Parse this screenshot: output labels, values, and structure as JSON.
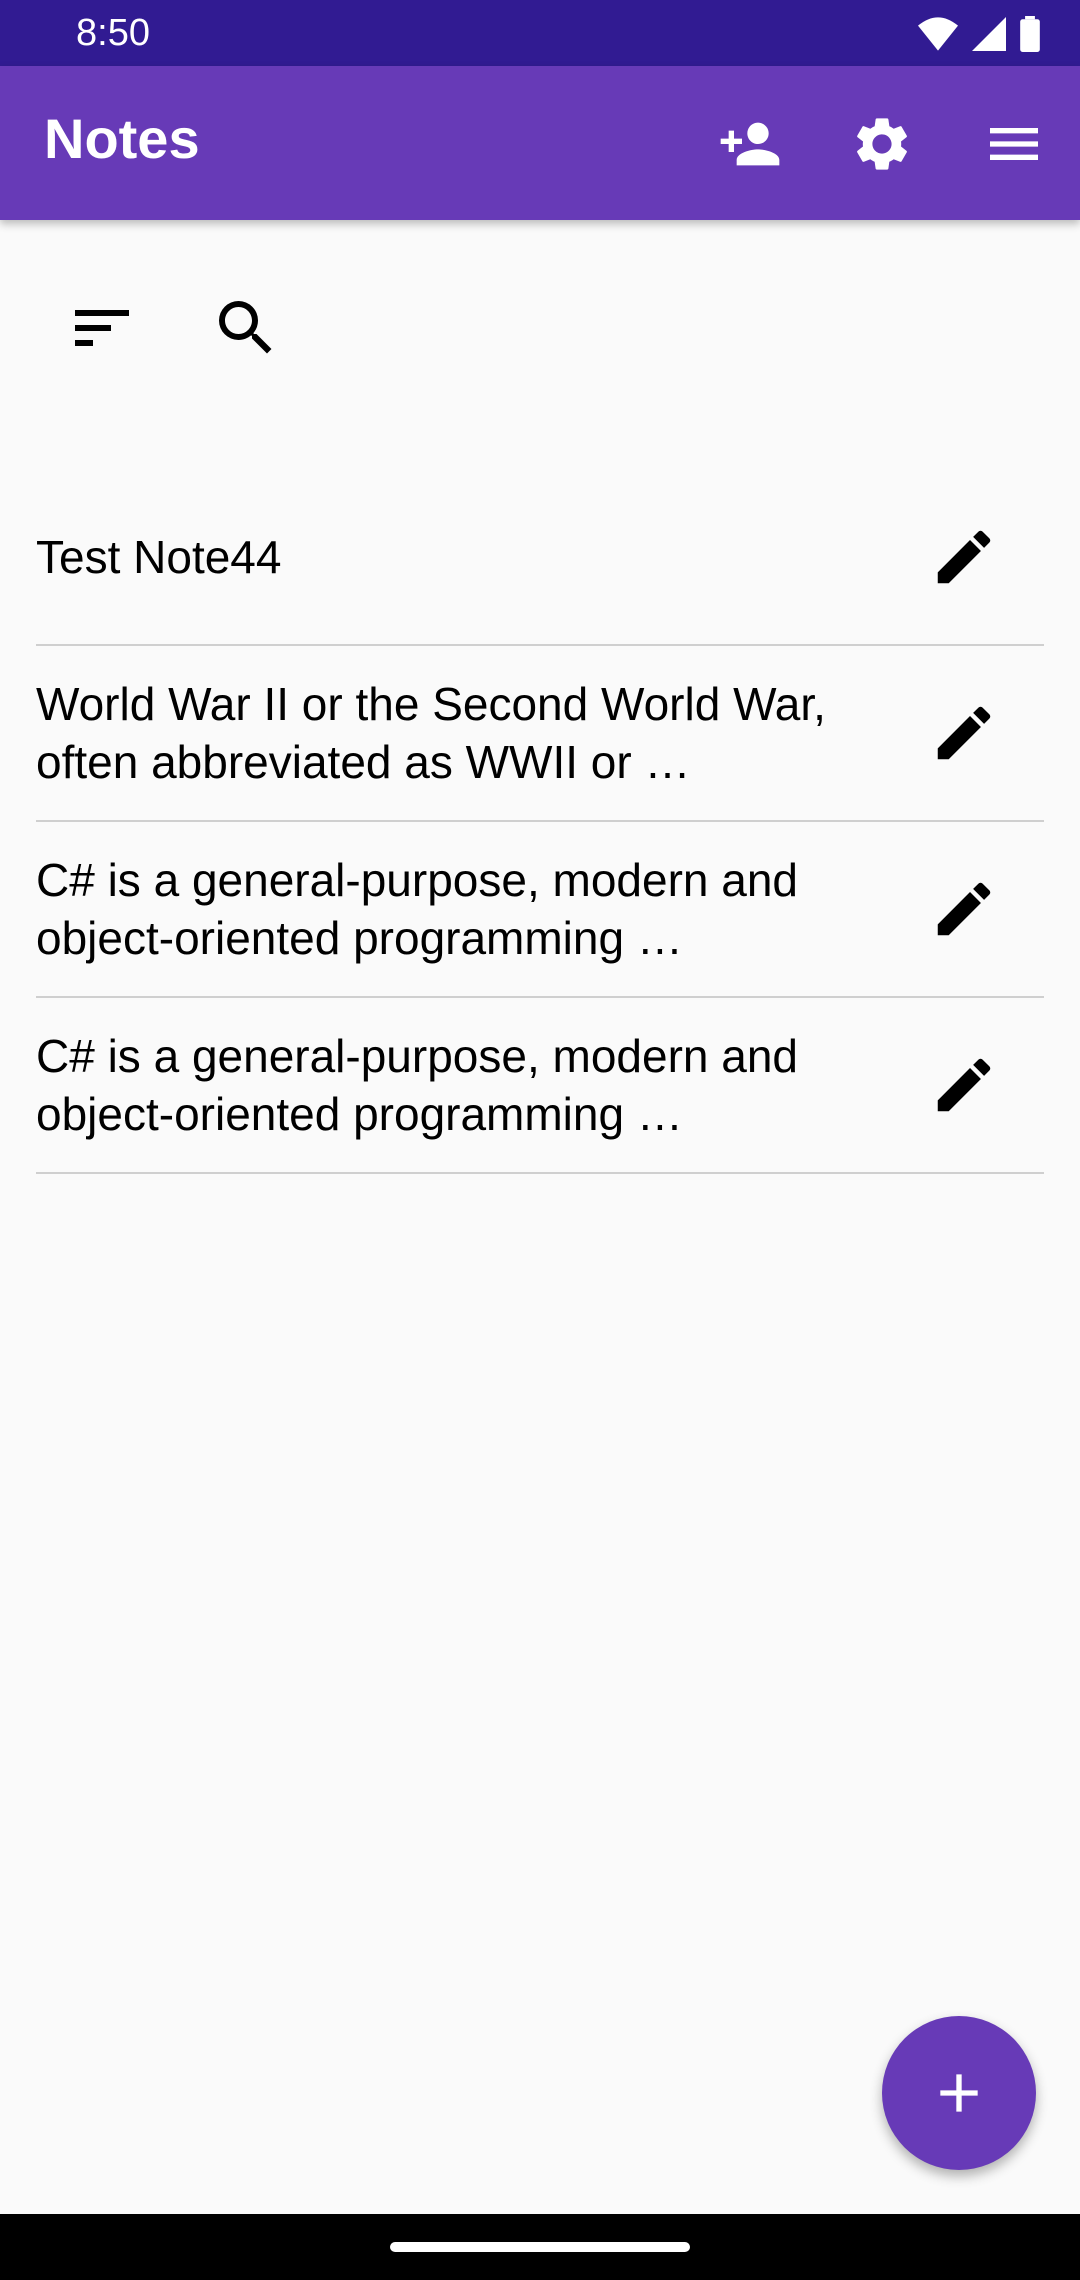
{
  "status_bar": {
    "time": "8:50",
    "icons": [
      "wifi-icon",
      "signal-icon",
      "battery-icon"
    ]
  },
  "app_bar": {
    "title": "Notes",
    "actions": [
      "add-person-icon",
      "gear-icon",
      "menu-icon"
    ],
    "color": "#673ab7"
  },
  "toolbar": {
    "icons": [
      "sort-icon",
      "search-icon"
    ]
  },
  "notes": [
    {
      "text": "Test Note44"
    },
    {
      "text": "World War II or the Second World War, often abbreviated as WWII or …"
    },
    {
      "text": "C# is a general-purpose, modern and object-oriented programming …"
    },
    {
      "text": "C# is a general-purpose, modern and object-oriented programming …"
    }
  ],
  "fab": {
    "icon": "plus-icon",
    "color": "#673ab7"
  },
  "colors": {
    "status_bar": "#311b92",
    "background": "#fafafa"
  }
}
